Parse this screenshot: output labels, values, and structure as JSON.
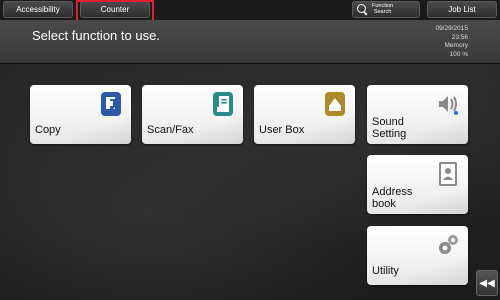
{
  "topbar": {
    "accessibility_label": "Accessibility",
    "counter_label": "Counter",
    "function_search_line1": "Function",
    "function_search_line2": "Search",
    "job_list_label": "Job List"
  },
  "header": {
    "title": "Select function to use.",
    "date": "09/29/2015",
    "time": "23:56",
    "memory_label": "Memory",
    "memory_value": "100 %"
  },
  "tiles": {
    "copy": "Copy",
    "scan_fax": "Scan/Fax",
    "user_box": "User Box",
    "sound_line1": "Sound",
    "sound_line2": "Setting",
    "address_line1": "Address",
    "address_line2": "book",
    "utility": "Utility"
  },
  "colors": {
    "highlight": "#e0202a",
    "copy_icon": "#2a5aa8",
    "scanfax_icon": "#2a8a8a",
    "userbox_icon": "#b08a2a",
    "gray_icon": "#8a8a8a"
  },
  "icons": {
    "collapse": "double-chevron-left-icon"
  }
}
